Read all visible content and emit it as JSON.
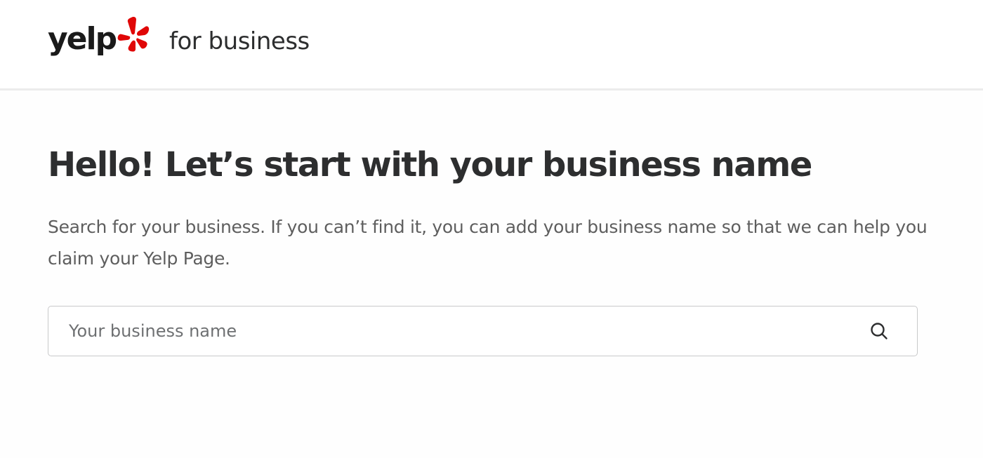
{
  "header": {
    "logo_text": "yelp",
    "logo_subtitle": "for business",
    "logo_burst_color": "#e00707"
  },
  "main": {
    "title": "Hello! Let’s start with your business name",
    "subtitle": "Search for your business. If you can’t find it, you can add your business name so that we can help you claim your Yelp Page.",
    "search": {
      "placeholder": "Your business name",
      "value": "",
      "icon": "search-icon"
    }
  }
}
